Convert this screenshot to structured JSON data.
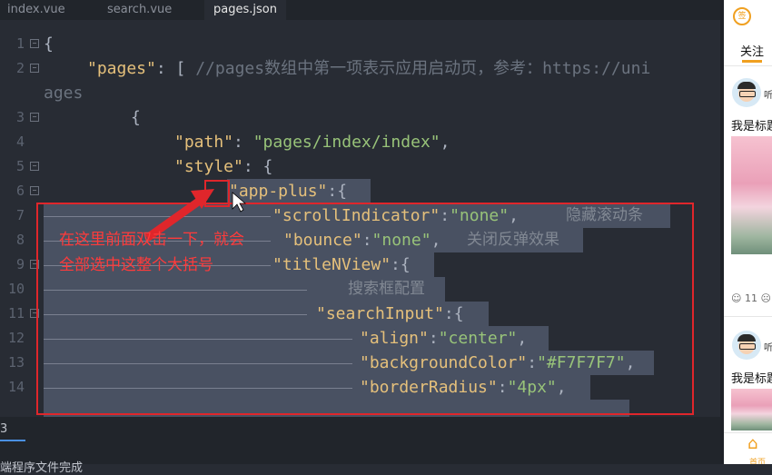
{
  "tabs": [
    {
      "label": "index.vue"
    },
    {
      "label": "search.vue"
    },
    {
      "label": "pages.json"
    }
  ],
  "code": {
    "line_numbers": [
      "1",
      "2",
      "3",
      "4",
      "5",
      "6",
      "7",
      "8",
      "9",
      "10",
      "11",
      "12",
      "13",
      "14"
    ],
    "l1": "{",
    "l2_key": "\"pages\"",
    "l2_punct": ": [ ",
    "l2_comment": "//pages数组中第一项表示应用启动页，参考：https://uni",
    "l2_wrap": "ages",
    "l4_brace": "{",
    "l5_key": "\"path\"",
    "l5_punct": ": ",
    "l5_val": "\"pages/index/index\"",
    "l5_end": ",",
    "l6_key": "\"style\"",
    "l6_punct": ": {",
    "l7_key": "\"app-plus\"",
    "l7_punct": ":{",
    "l8_key": "\"scrollIndicator\"",
    "l8_punct": ":",
    "l8_val": "\"none\"",
    "l8_end": ",",
    "l8_comment": "隐藏滚动条",
    "l9_key": "\"bounce\"",
    "l9_punct": ":",
    "l9_val": "\"none\"",
    "l9_end": ",",
    "l9_comment": "关闭反弹效果",
    "l10_key": "\"titleNView\"",
    "l10_punct": ":{",
    "l11_comment": "搜索框配置",
    "l12_key": "\"searchInput\"",
    "l12_punct": ":{",
    "l13_key": "\"align\"",
    "l13_punct": ":",
    "l13_val": "\"center\"",
    "l13_end": ",",
    "l14_key": "\"backgroundColor\"",
    "l14_punct": ":",
    "l14_val": "\"#F7F7F7\"",
    "l14_end": ",",
    "l15_key": "\"borderRadius\"",
    "l15_punct": ":",
    "l15_val": "\"4px\"",
    "l15_end": ","
  },
  "annotation": {
    "line1": "在这里前面双击一下，就会",
    "line2": "全部选中这整个大括号"
  },
  "bottom": {
    "tab": "3",
    "message": "端程序文件完成"
  },
  "phone": {
    "sign_label": "签",
    "follow_tab": "关注",
    "post_user": "听",
    "post_title": "我是标题",
    "reaction_count": "11",
    "home_label": "首页"
  },
  "colors": {
    "accent": "#f0a020",
    "annotation_red": "#e0262b",
    "selection": "#495162"
  }
}
